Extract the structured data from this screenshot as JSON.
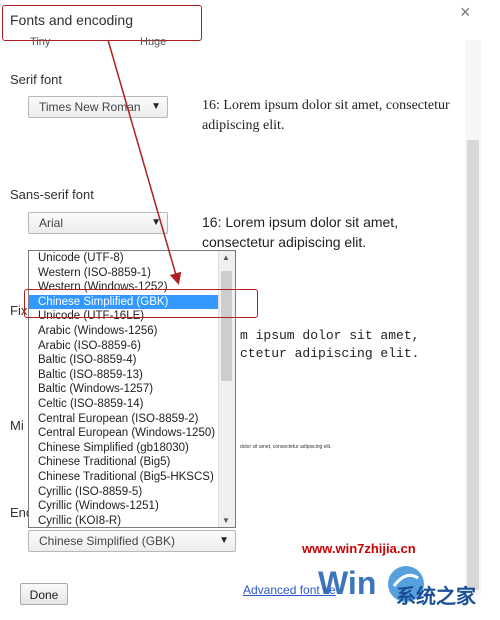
{
  "dialog": {
    "title": "Fonts and encoding",
    "close_label": "×",
    "size_min_label": "Tiny",
    "size_max_label": "Huge"
  },
  "serif": {
    "label": "Serif font",
    "selected": "Times New Roman",
    "preview": "16: Lorem ipsum dolor sit amet, consectetur adipiscing elit."
  },
  "sans_serif": {
    "label": "Sans-serif font",
    "selected": "Arial",
    "preview": "16: Lorem ipsum dolor sit amet, consectetur adipiscing elit."
  },
  "fixed": {
    "label_fragment": "Fix",
    "preview_line1": "m ipsum dolor sit amet,",
    "preview_line2": "ctetur adipiscing elit."
  },
  "minimum": {
    "label_fragment": "Mi",
    "preview": "dolor sit amet, consectetur adipiscing elit."
  },
  "encoding": {
    "label_fragment": "Enc",
    "selected": "Chinese Simplified (GBK)",
    "options": [
      "Unicode (UTF-8)",
      "Western (ISO-8859-1)",
      "Western (Windows-1252)",
      "Chinese Simplified (GBK)",
      "Unicode (UTF-16LE)",
      "Arabic (Windows-1256)",
      "Arabic (ISO-8859-6)",
      "Baltic (ISO-8859-4)",
      "Baltic (ISO-8859-13)",
      "Baltic (Windows-1257)",
      "Celtic (ISO-8859-14)",
      "Central European (ISO-8859-2)",
      "Central European (Windows-1250)",
      "Chinese Simplified (gb18030)",
      "Chinese Traditional (Big5)",
      "Chinese Traditional (Big5-HKSCS)",
      "Cyrillic (ISO-8859-5)",
      "Cyrillic (Windows-1251)",
      "Cyrillic (KOI8-R)"
    ],
    "highlighted_index": 3
  },
  "footer": {
    "done_label": "Done",
    "advanced_link": "Advanced font se"
  },
  "watermark": {
    "url": "www.win7zhijia.cn",
    "brand": "系统之家"
  },
  "colors": {
    "callout": "#b02020",
    "selection": "#3399ff",
    "watermark_url": "#cc0000",
    "link": "#2a56c6"
  }
}
